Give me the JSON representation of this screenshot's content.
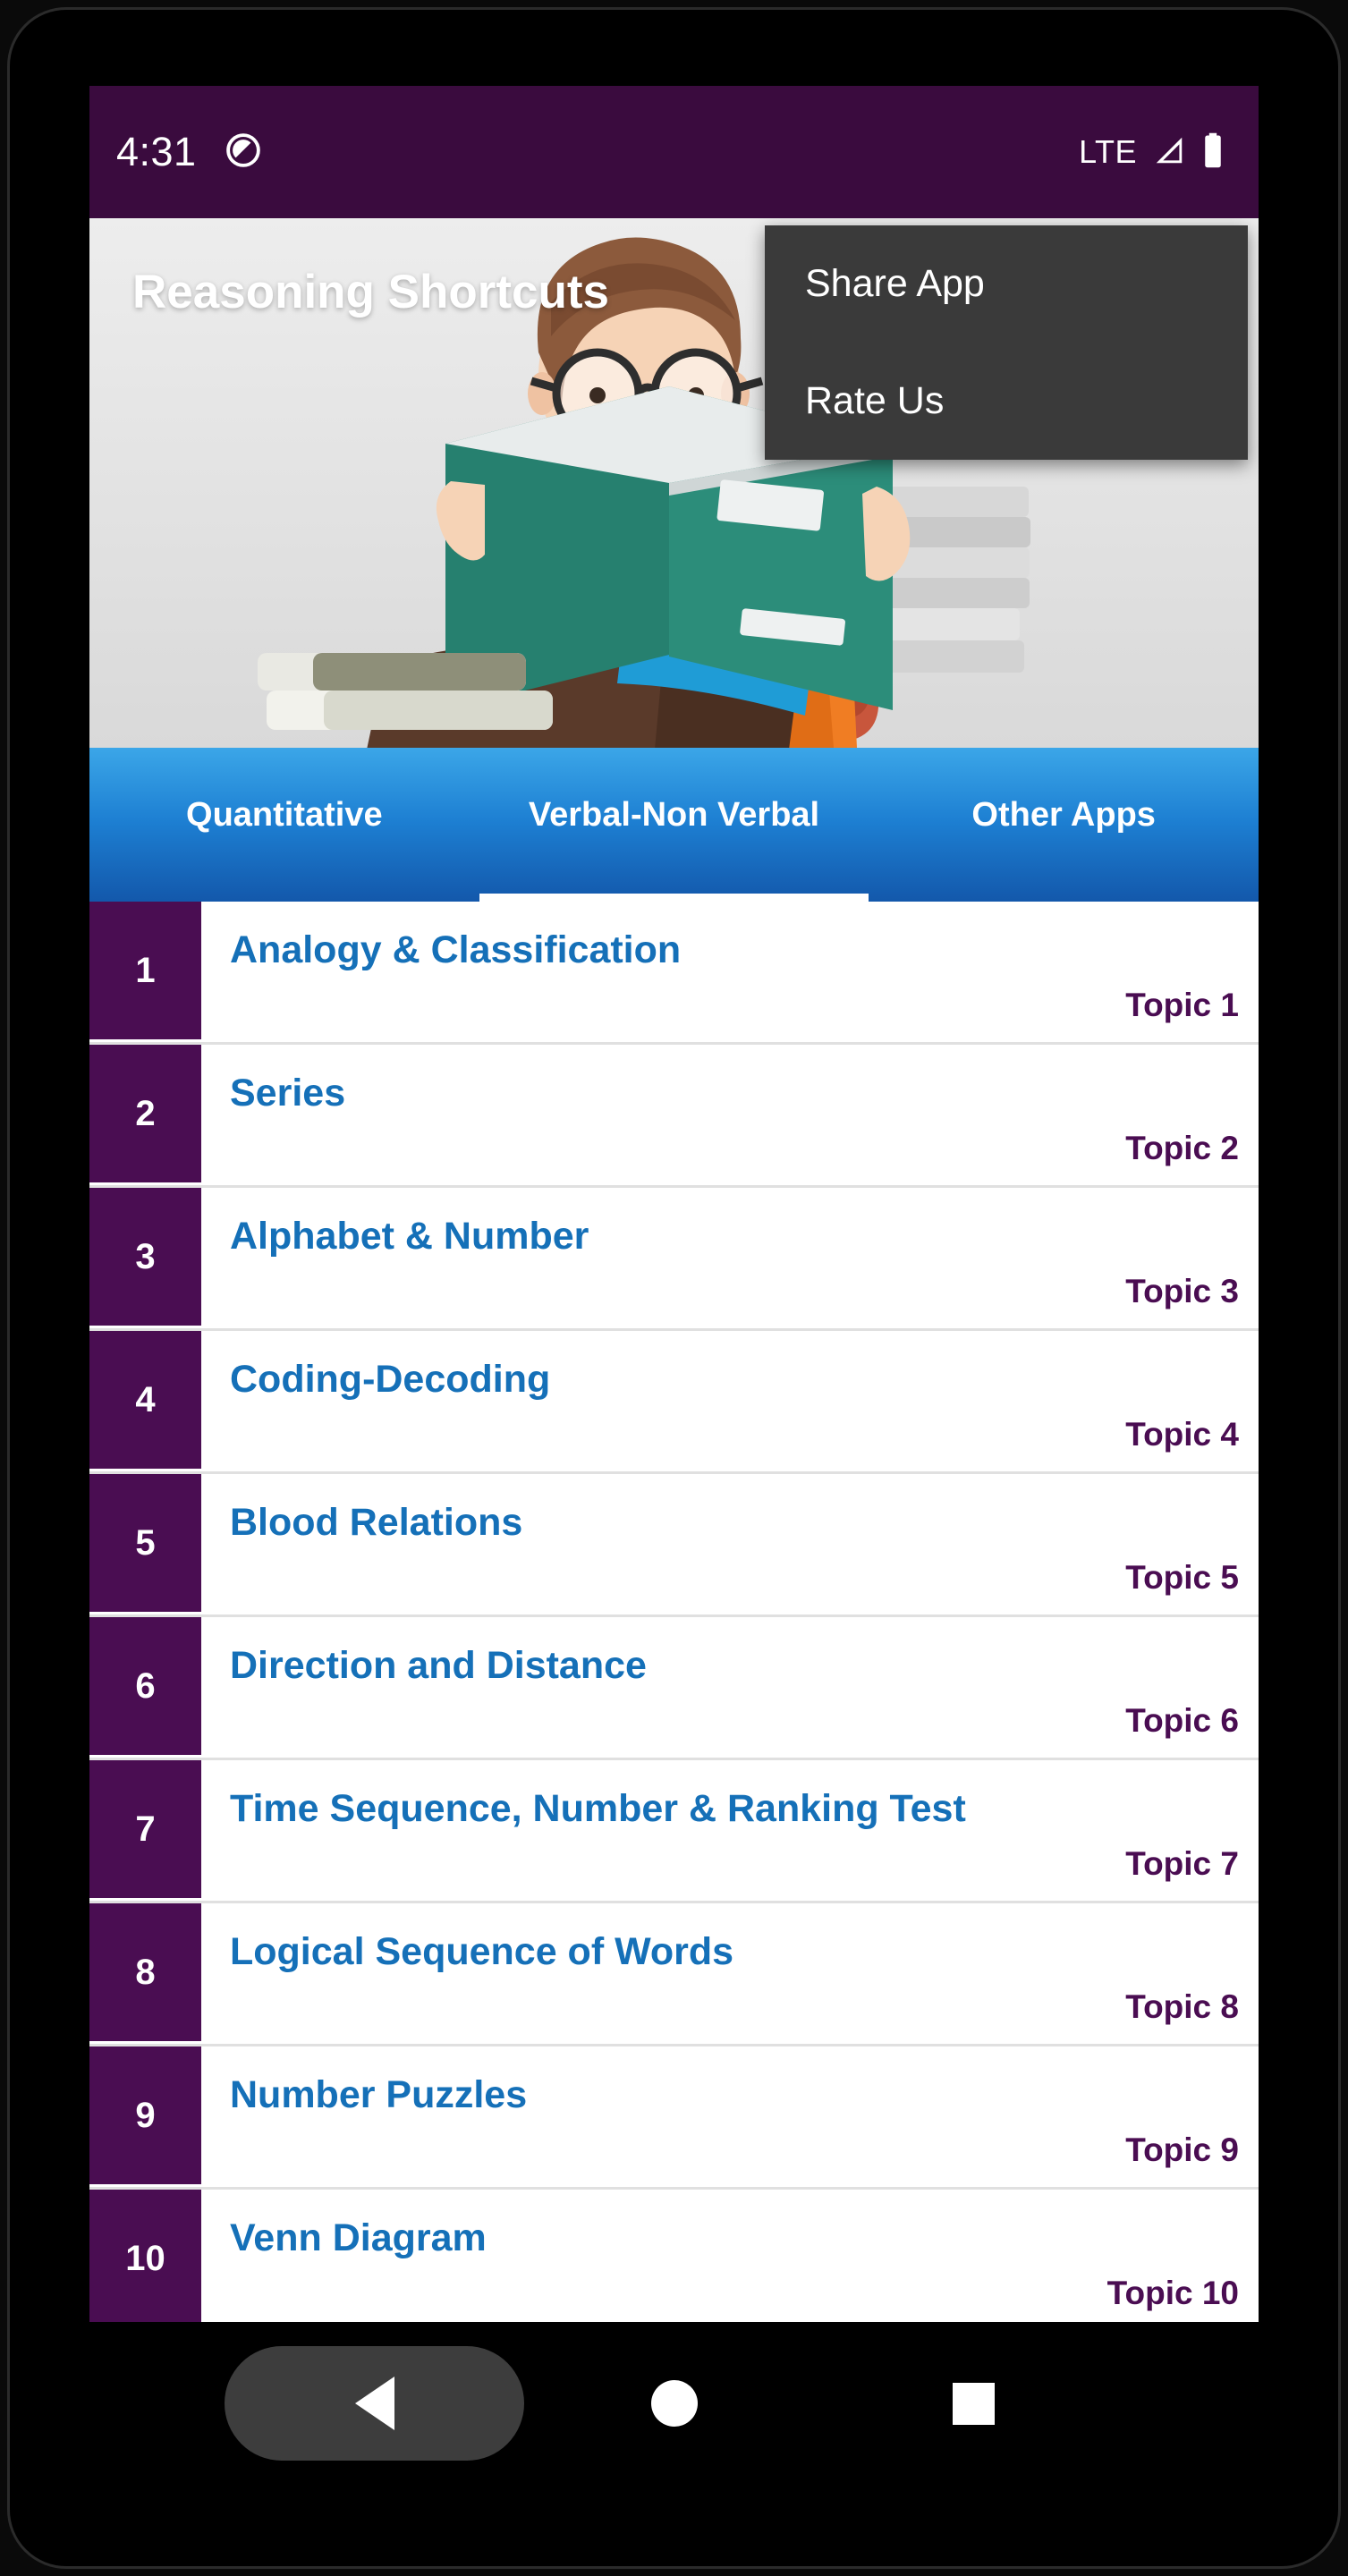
{
  "status_bar": {
    "time": "4:31",
    "dnd_icon": "do-not-disturb-icon",
    "network_label": "LTE",
    "signal_icon": "signal-bars-icon",
    "battery_icon": "battery-full-icon"
  },
  "banner": {
    "title": "Reasoning Shortcuts",
    "illustration": "student-reading-book-illustration"
  },
  "overflow_menu": {
    "items": [
      {
        "label": "Share App"
      },
      {
        "label": "Rate Us"
      }
    ]
  },
  "tabs": [
    {
      "label": "Quantitative",
      "active": false
    },
    {
      "label": "Verbal-Non Verbal",
      "active": true
    },
    {
      "label": "Other Apps",
      "active": false
    }
  ],
  "list": {
    "rows": [
      {
        "index": "1",
        "title": "Analogy & Classification",
        "topic": "Topic 1"
      },
      {
        "index": "2",
        "title": "Series",
        "topic": "Topic 2"
      },
      {
        "index": "3",
        "title": "Alphabet & Number",
        "topic": "Topic 3"
      },
      {
        "index": "4",
        "title": "Coding-Decoding",
        "topic": "Topic 4"
      },
      {
        "index": "5",
        "title": "Blood Relations",
        "topic": "Topic 5"
      },
      {
        "index": "6",
        "title": "Direction and Distance",
        "topic": "Topic 6"
      },
      {
        "index": "7",
        "title": "Time Sequence, Number & Ranking Test",
        "topic": "Topic 7"
      },
      {
        "index": "8",
        "title": "Logical Sequence of Words",
        "topic": "Topic 8"
      },
      {
        "index": "9",
        "title": "Number Puzzles",
        "topic": "Topic 9"
      },
      {
        "index": "10",
        "title": "Venn Diagram",
        "topic": "Topic 10"
      }
    ]
  },
  "nav_bar": {
    "back": "back-triangle-icon",
    "home": "home-circle-icon",
    "recents": "recents-square-icon"
  },
  "colors": {
    "status_bar": "#3a0b3e",
    "index_box": "#4a0d52",
    "title_blue": "#1570b8",
    "tab_top": "#3ba6e8",
    "tab_bottom": "#1358ab",
    "popup_bg": "#3a3a3a"
  }
}
